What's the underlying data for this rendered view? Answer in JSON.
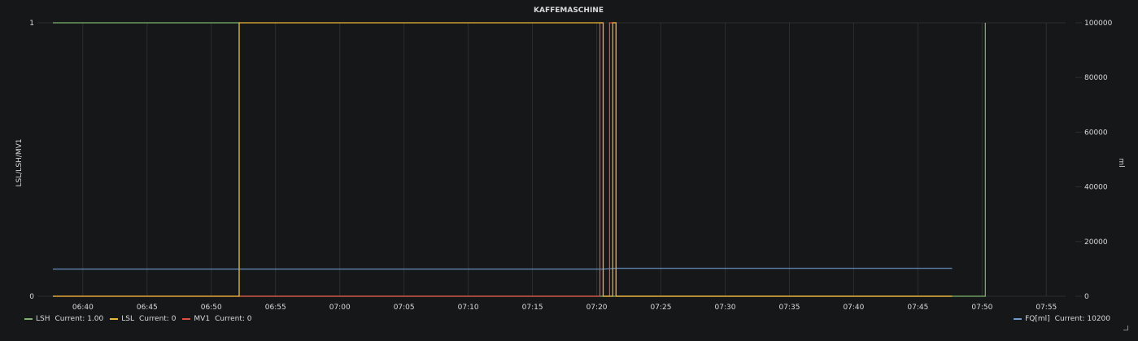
{
  "chart_data": {
    "type": "line",
    "title": "KAFFEMASCHINE",
    "ylabel_left": "LSL/LSH/MV1",
    "ylabel_right": "ml",
    "y_left_ticks": [
      "0",
      "1"
    ],
    "y_left_range": [
      0,
      1
    ],
    "y_right_ticks": [
      "0",
      "20000",
      "40000",
      "60000",
      "80000",
      "100000"
    ],
    "y_right_range": [
      0,
      100000
    ],
    "x_range": [
      "06:37:40",
      "07:56:30"
    ],
    "x_ticks": [
      "06:40",
      "06:45",
      "06:50",
      "06:55",
      "07:00",
      "07:05",
      "07:10",
      "07:15",
      "07:20",
      "07:25",
      "07:30",
      "07:35",
      "07:40",
      "07:45",
      "07:50",
      "07:55"
    ],
    "grid": true,
    "legend_left": "bottom-left",
    "legend_right": "bottom-right",
    "series": [
      {
        "name": "LSH",
        "current": "Current: 1.00",
        "color": "#7eb26d",
        "axis": "left",
        "points": [
          [
            "06:37:40",
            1
          ],
          [
            "06:52:10",
            1
          ],
          [
            "06:52:10",
            0
          ],
          [
            "07:47:40",
            0
          ],
          [
            "07:50:15",
            0
          ],
          [
            "07:50:15",
            1
          ]
        ]
      },
      {
        "name": "LSL",
        "current": "Current: 0",
        "color": "#eab839",
        "axis": "left",
        "points": [
          [
            "06:37:40",
            0
          ],
          [
            "06:52:10",
            0
          ],
          [
            "06:52:10",
            1
          ],
          [
            "07:20:30",
            1
          ],
          [
            "07:20:30",
            0
          ],
          [
            "07:21:15",
            0
          ],
          [
            "07:21:15",
            1
          ],
          [
            "07:21:30",
            1
          ],
          [
            "07:21:30",
            0
          ],
          [
            "07:47:40",
            0
          ]
        ]
      },
      {
        "name": "MV1",
        "current": "Current: 0",
        "color": "#e24d42",
        "axis": "left",
        "points": [
          [
            "06:37:40",
            0
          ],
          [
            "07:20:15",
            0
          ],
          [
            "07:20:15",
            1
          ],
          [
            "07:20:30",
            1
          ],
          [
            "07:20:30",
            0
          ],
          [
            "07:21:00",
            0
          ],
          [
            "07:21:00",
            1
          ],
          [
            "07:21:30",
            1
          ],
          [
            "07:21:30",
            0
          ],
          [
            "07:47:40",
            0
          ]
        ]
      },
      {
        "name": "FQ[ml]",
        "current": "Current: 10200",
        "color": "#6d9ccf",
        "axis": "right",
        "points": [
          [
            "06:37:40",
            9900
          ],
          [
            "07:20:30",
            9900
          ],
          [
            "07:21:30",
            10200
          ],
          [
            "07:47:40",
            10200
          ]
        ]
      }
    ]
  }
}
